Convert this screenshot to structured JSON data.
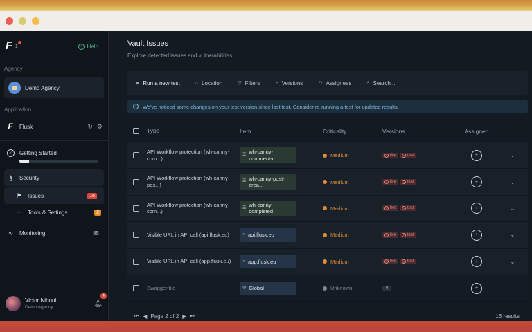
{
  "sidebar": {
    "logo_badge": "1",
    "help_label": "Help",
    "agency_section": "Agency",
    "agency_name": "Demo Agency",
    "application_section": "Application",
    "app_name": "Flusk",
    "getting_started": "Getting Started",
    "getting_started_progress": 0.12,
    "security": "Security",
    "issues": "Issues",
    "issues_count": "16",
    "tools": "Tools & Settings",
    "tools_count": "2",
    "monitoring": "Monitoring",
    "monitoring_count": "85",
    "user_name": "Victor Nihoul",
    "user_role": "Demo Agency",
    "notif_count": "4"
  },
  "page": {
    "title": "Vault Issues",
    "subtitle": "Explore detected issues and vulnerabilities."
  },
  "toolbar": {
    "run_test": "Run a new test",
    "location": "Location",
    "filters": "Filters",
    "versions": "Versions",
    "assignees": "Assignees",
    "search_placeholder": "Search..."
  },
  "notice": "We've noticed some changes on your test version since last test. Consider re-running a test for updated results.",
  "table": {
    "headers": {
      "type": "Type",
      "item": "Item",
      "criticality": "Criticality",
      "versions": "Versions",
      "assigned": "Assigned"
    },
    "rows": [
      {
        "type": "API Workflow protection (wh-canny-com...)",
        "item": "wh-canny-comment-c...",
        "criticality": "Medium",
        "v1": "live",
        "v2": "test"
      },
      {
        "type": "API Workflow protection (wh-canny-pos...)",
        "item": "wh-canny-post-crea...",
        "criticality": "Medium",
        "v1": "live",
        "v2": "test"
      },
      {
        "type": "API Workflow protection (wh-canny-com...)",
        "item": "wh-canny-completed",
        "criticality": "Medium",
        "v1": "live",
        "v2": "test"
      },
      {
        "type": "Visible URL in API call (api.flusk.eu)",
        "item": "api.flusk.eu",
        "criticality": "Medium",
        "v1": "live",
        "v2": "test"
      },
      {
        "type": "Visible URL in API call (app.flusk.eu)",
        "item": "app.flusk.eu",
        "criticality": "Medium",
        "v1": "live",
        "v2": "test"
      },
      {
        "type": "Swagger file",
        "item": "Global",
        "criticality": "Unknown",
        "v1": "0"
      }
    ]
  },
  "pager": {
    "page_label": "Page 2 of 2",
    "results": "16 results"
  },
  "colors": {
    "medium": "#e08b3a",
    "issues_badge": "#d6463b",
    "tools_badge": "#e38c23"
  }
}
